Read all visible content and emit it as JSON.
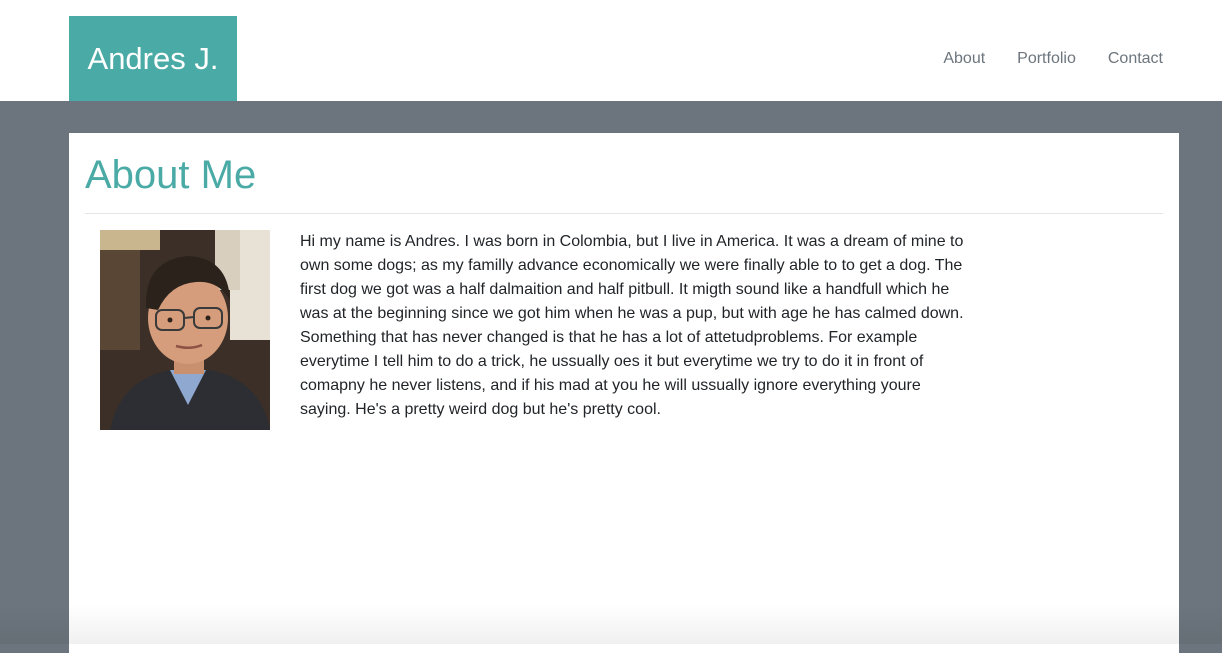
{
  "header": {
    "brand": "Andres J.",
    "nav": [
      {
        "label": "About"
      },
      {
        "label": "Portfolio"
      },
      {
        "label": "Contact"
      }
    ]
  },
  "main": {
    "title": "About Me",
    "photo_icon": "profile-photo",
    "bio": "Hi my name is Andres. I was born in Colombia, but I live in America. It was a dream of mine to own some dogs; as my familly advance economically we were finally able to to get a dog. The first dog we got was a half dalmaition and half pitbull. It migth sound like a handfull which he was at the beginning since we got him when he was a pup, but with age he has calmed down. Something that has never changed is that he has a lot of attetudproblems. For example everytime I tell him to do a trick, he ussually oes it but everytime we try to do it in front of comapny he never listens, and if his mad at you he will ussually ignore everything youre saying. He's a pretty weird dog but he's pretty cool."
  },
  "colors": {
    "accent": "#4aaaa5",
    "background": "#6c757d",
    "nav_text": "#6c757d"
  }
}
